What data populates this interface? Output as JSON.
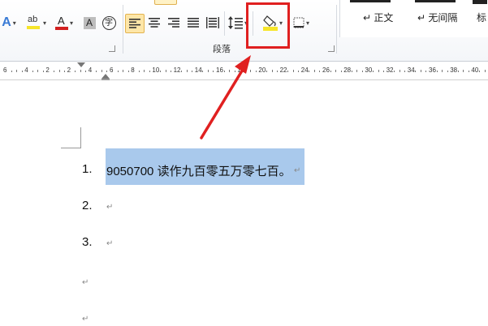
{
  "ribbon": {
    "paragraph_group_label": "段落",
    "styles": {
      "items": [
        {
          "label": "↵ 正文"
        },
        {
          "label": "↵ 无间隔"
        },
        {
          "label": "标"
        }
      ]
    },
    "font_buttons": {
      "text_effect_icon": "text-effect-icon",
      "highlight_label": "ab",
      "font_color_label": "A",
      "char_shading_label": "A",
      "enclose_char_label": "字"
    },
    "highlight_color": "#f6e52a",
    "font_color": "#d22020",
    "annotation_color": "#e02020"
  },
  "ruler": {
    "numbers": [
      "6",
      "4",
      "2",
      "2",
      "4",
      "6",
      "8",
      "10",
      "12",
      "14",
      "16",
      "18",
      "20",
      "22",
      "24",
      "26",
      "28",
      "30",
      "32",
      "34",
      "36",
      "38",
      "40"
    ]
  },
  "document": {
    "items": [
      {
        "number": "1.",
        "text": "9050700 读作九百零五万零七百。",
        "mark": "↵"
      },
      {
        "number": "2.",
        "text": "",
        "mark": "↵"
      },
      {
        "number": "3.",
        "text": "",
        "mark": "↵"
      }
    ],
    "trailing_marks": [
      "↵",
      "↵"
    ],
    "selection_color": "#a9c9ec"
  }
}
